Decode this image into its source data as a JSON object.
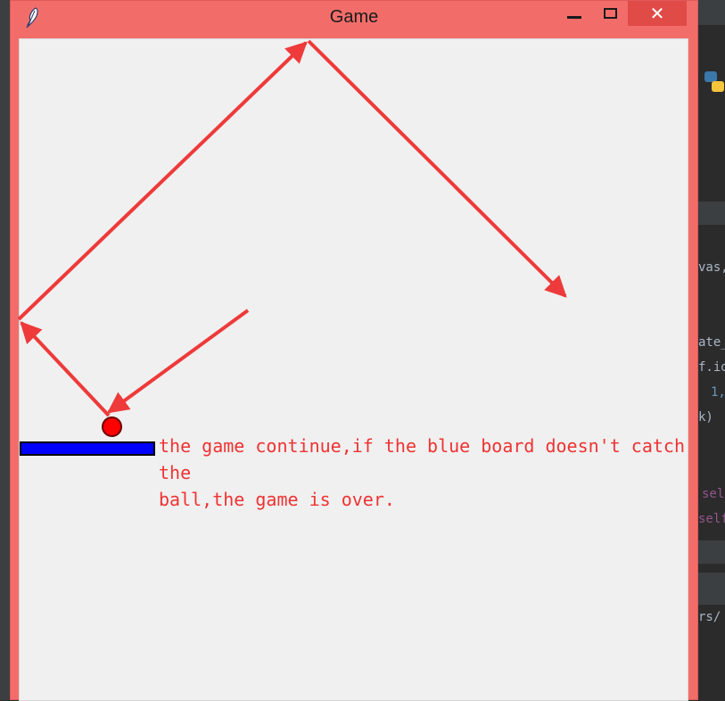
{
  "window": {
    "title": "Game",
    "close_label": "✕"
  },
  "annotation": {
    "line1": "the game continue,if the blue board doesn't catch the",
    "line2": "ball,the game is over."
  },
  "ide_background": {
    "snippets": [
      "vas,",
      "ate_",
      "f.id",
      "1,",
      "k)",
      "sel",
      "self",
      "rs/"
    ]
  },
  "colors": {
    "window_frame": "#f26d6a",
    "close_button": "#e04a47",
    "canvas": "#f0f0f0",
    "board": "#0000ff",
    "ball": "#ff0000",
    "annotation": "#ee3333"
  }
}
